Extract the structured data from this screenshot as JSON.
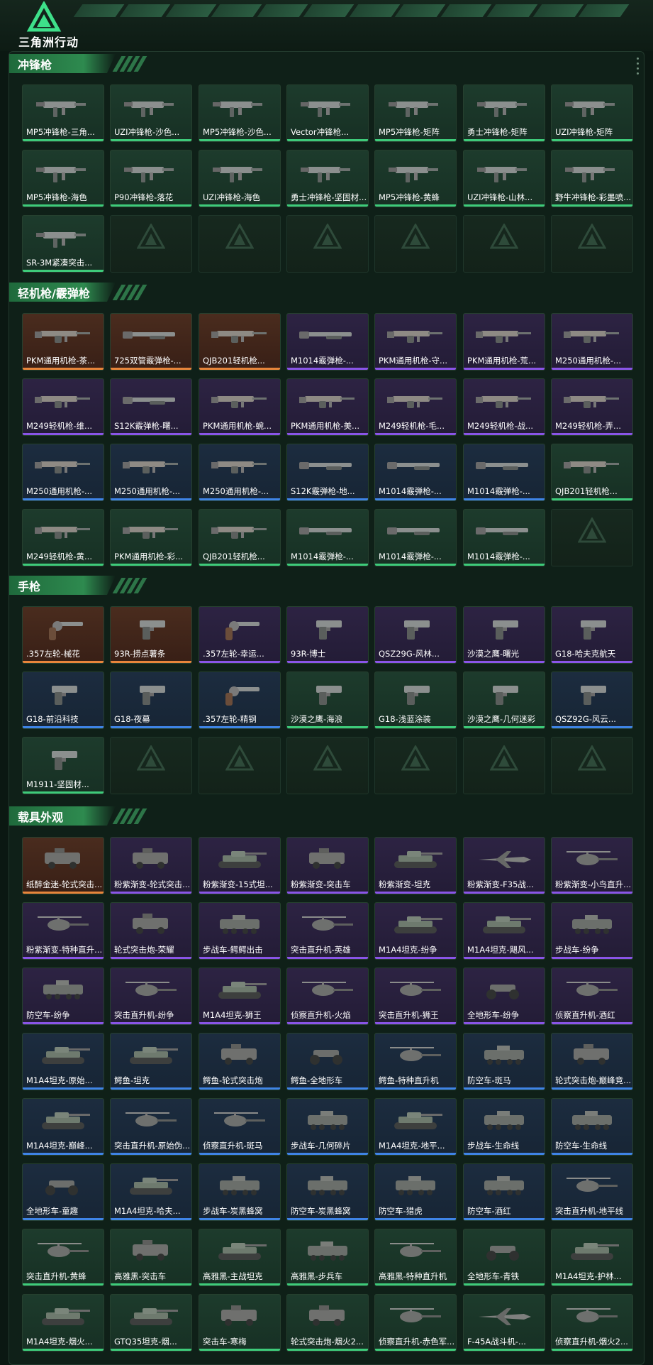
{
  "app": {
    "logo_text": "三角洲行动"
  },
  "colors": {
    "green": "#3ecb7a",
    "blue": "#3f84e6",
    "purple": "#8a55e8",
    "orange": "#e8853b"
  },
  "sections": [
    {
      "title": "冲锋枪",
      "items": [
        {
          "label": "MP5冲锋枪-三角...",
          "rarity": "green",
          "icon": "smg-icon"
        },
        {
          "label": "UZI冲锋枪-沙色...",
          "rarity": "green",
          "icon": "smg-icon"
        },
        {
          "label": "MP5冲锋枪-沙色...",
          "rarity": "green",
          "icon": "smg-icon"
        },
        {
          "label": "Vector冲锋枪...",
          "rarity": "green",
          "icon": "smg-icon"
        },
        {
          "label": "MP5冲锋枪-矩阵",
          "rarity": "green",
          "icon": "smg-icon"
        },
        {
          "label": "勇士冲锋枪-矩阵",
          "rarity": "green",
          "icon": "smg-icon"
        },
        {
          "label": "UZI冲锋枪-矩阵",
          "rarity": "green",
          "icon": "smg-icon"
        },
        {
          "label": "MP5冲锋枪-海色",
          "rarity": "green",
          "icon": "smg-icon"
        },
        {
          "label": "P90冲锋枪-落花",
          "rarity": "green",
          "icon": "smg-icon"
        },
        {
          "label": "UZI冲锋枪-海色",
          "rarity": "green",
          "icon": "smg-icon"
        },
        {
          "label": "勇士冲锋枪-坚固材...",
          "rarity": "green",
          "icon": "smg-icon"
        },
        {
          "label": "MP5冲锋枪-黄蜂",
          "rarity": "green",
          "icon": "smg-icon"
        },
        {
          "label": "UZI冲锋枪-山林...",
          "rarity": "green",
          "icon": "smg-icon"
        },
        {
          "label": "野牛冲锋枪-彩墨喷...",
          "rarity": "green",
          "icon": "smg-icon"
        },
        {
          "label": "SR-3M紧凑突击...",
          "rarity": "green",
          "icon": "smg-icon"
        },
        {
          "label": "",
          "rarity": "empty"
        },
        {
          "label": "",
          "rarity": "empty"
        },
        {
          "label": "",
          "rarity": "empty"
        },
        {
          "label": "",
          "rarity": "empty"
        },
        {
          "label": "",
          "rarity": "empty"
        },
        {
          "label": "",
          "rarity": "empty"
        }
      ]
    },
    {
      "title": "轻机枪/霰弹枪",
      "items": [
        {
          "label": "PKM通用机枪-茶...",
          "rarity": "orange",
          "icon": "lmg-icon"
        },
        {
          "label": "725双管霰弹枪-...",
          "rarity": "orange",
          "icon": "shotgun-icon"
        },
        {
          "label": "QJB201轻机枪...",
          "rarity": "orange",
          "icon": "lmg-icon"
        },
        {
          "label": "M1014霰弹枪-...",
          "rarity": "purple",
          "icon": "shotgun-icon"
        },
        {
          "label": "PKM通用机枪-守...",
          "rarity": "purple",
          "icon": "lmg-icon"
        },
        {
          "label": "PKM通用机枪-荒...",
          "rarity": "purple",
          "icon": "lmg-icon"
        },
        {
          "label": "M250通用机枪-...",
          "rarity": "purple",
          "icon": "lmg-icon"
        },
        {
          "label": "M249轻机枪-维...",
          "rarity": "purple",
          "icon": "lmg-icon"
        },
        {
          "label": "S12K霰弹枪-曙...",
          "rarity": "purple",
          "icon": "shotgun-icon"
        },
        {
          "label": "PKM通用机枪-蜿...",
          "rarity": "purple",
          "icon": "lmg-icon"
        },
        {
          "label": "PKM通用机枪-美...",
          "rarity": "purple",
          "icon": "lmg-icon"
        },
        {
          "label": "M249轻机枪-毛...",
          "rarity": "purple",
          "icon": "lmg-icon"
        },
        {
          "label": "M249轻机枪-战...",
          "rarity": "purple",
          "icon": "lmg-icon"
        },
        {
          "label": "M249轻机枪-弄...",
          "rarity": "purple",
          "icon": "lmg-icon"
        },
        {
          "label": "M250通用机枪-...",
          "rarity": "blue",
          "icon": "lmg-icon"
        },
        {
          "label": "M250通用机枪-...",
          "rarity": "blue",
          "icon": "lmg-icon"
        },
        {
          "label": "M250通用机枪-...",
          "rarity": "blue",
          "icon": "lmg-icon"
        },
        {
          "label": "S12K霰弹枪-地...",
          "rarity": "blue",
          "icon": "shotgun-icon"
        },
        {
          "label": "M1014霰弹枪-...",
          "rarity": "blue",
          "icon": "shotgun-icon"
        },
        {
          "label": "M1014霰弹枪-...",
          "rarity": "blue",
          "icon": "shotgun-icon"
        },
        {
          "label": "QJB201轻机枪...",
          "rarity": "green",
          "icon": "lmg-icon"
        },
        {
          "label": "M249轻机枪-黄...",
          "rarity": "green",
          "icon": "lmg-icon"
        },
        {
          "label": "PKM通用机枪-彩...",
          "rarity": "green",
          "icon": "lmg-icon"
        },
        {
          "label": "QJB201轻机枪...",
          "rarity": "green",
          "icon": "lmg-icon"
        },
        {
          "label": "M1014霰弹枪-...",
          "rarity": "green",
          "icon": "shotgun-icon"
        },
        {
          "label": "M1014霰弹枪-...",
          "rarity": "green",
          "icon": "shotgun-icon"
        },
        {
          "label": "M1014霰弹枪-...",
          "rarity": "green",
          "icon": "shotgun-icon"
        },
        {
          "label": "",
          "rarity": "empty"
        }
      ]
    },
    {
      "title": "手枪",
      "items": [
        {
          "label": ".357左轮-械花",
          "rarity": "orange",
          "icon": "revolver-icon"
        },
        {
          "label": "93R-捞点薯条",
          "rarity": "orange",
          "icon": "pistol-icon"
        },
        {
          "label": ".357左轮-幸运...",
          "rarity": "purple",
          "icon": "revolver-icon"
        },
        {
          "label": "93R-博士",
          "rarity": "purple",
          "icon": "pistol-icon"
        },
        {
          "label": "QSZ29G-风林...",
          "rarity": "purple",
          "icon": "pistol-icon"
        },
        {
          "label": "沙漠之鹰-曙光",
          "rarity": "purple",
          "icon": "pistol-icon"
        },
        {
          "label": "G18-哈夫克航天",
          "rarity": "purple",
          "icon": "pistol-icon"
        },
        {
          "label": "G18-前沿科技",
          "rarity": "blue",
          "icon": "pistol-icon"
        },
        {
          "label": "G18-夜幕",
          "rarity": "blue",
          "icon": "pistol-icon"
        },
        {
          "label": ".357左轮-精钢",
          "rarity": "blue",
          "icon": "revolver-icon"
        },
        {
          "label": "沙漠之鹰-海浪",
          "rarity": "green",
          "icon": "pistol-icon"
        },
        {
          "label": "G18-浅蓝涂装",
          "rarity": "green",
          "icon": "pistol-icon"
        },
        {
          "label": "沙漠之鹰-几何迷彩",
          "rarity": "green",
          "icon": "pistol-icon"
        },
        {
          "label": "QSZ92G-风云...",
          "rarity": "blue",
          "icon": "pistol-icon"
        },
        {
          "label": "M1911-坚固材...",
          "rarity": "green",
          "icon": "pistol-icon"
        },
        {
          "label": "",
          "rarity": "empty"
        },
        {
          "label": "",
          "rarity": "empty"
        },
        {
          "label": "",
          "rarity": "empty"
        },
        {
          "label": "",
          "rarity": "empty"
        },
        {
          "label": "",
          "rarity": "empty"
        },
        {
          "label": "",
          "rarity": "empty"
        }
      ]
    },
    {
      "title": "载具外观",
      "items": [
        {
          "label": "纸醉金迷-轮式突击...",
          "rarity": "orange",
          "icon": "armored-car-icon"
        },
        {
          "label": "粉紫渐变-轮式突击...",
          "rarity": "purple",
          "icon": "armored-car-icon"
        },
        {
          "label": "粉紫渐变-15式坦...",
          "rarity": "purple",
          "icon": "tank-icon"
        },
        {
          "label": "粉紫渐变-突击车",
          "rarity": "purple",
          "icon": "armored-car-icon"
        },
        {
          "label": "粉紫渐变-坦克",
          "rarity": "purple",
          "icon": "tank-icon"
        },
        {
          "label": "粉紫渐变-F35战...",
          "rarity": "purple",
          "icon": "jet-icon"
        },
        {
          "label": "粉紫渐变-小鸟直升...",
          "rarity": "purple",
          "icon": "helicopter-icon"
        },
        {
          "label": "粉紫渐变-特种直升...",
          "rarity": "purple",
          "icon": "helicopter-icon"
        },
        {
          "label": "轮式突击炮-荣耀",
          "rarity": "purple",
          "icon": "armored-car-icon"
        },
        {
          "label": "步战车-鳄鳄出击",
          "rarity": "purple",
          "icon": "ifv-icon"
        },
        {
          "label": "突击直升机-英雄",
          "rarity": "purple",
          "icon": "helicopter-icon"
        },
        {
          "label": "M1A4坦克-纷争",
          "rarity": "purple",
          "icon": "tank-icon"
        },
        {
          "label": "M1A4坦克-飓风...",
          "rarity": "purple",
          "icon": "tank-icon"
        },
        {
          "label": "步战车-纷争",
          "rarity": "purple",
          "icon": "ifv-icon"
        },
        {
          "label": "防空车-纷争",
          "rarity": "purple",
          "icon": "ifv-icon"
        },
        {
          "label": "突击直升机-纷争",
          "rarity": "purple",
          "icon": "helicopter-icon"
        },
        {
          "label": "M1A4坦克-狮王",
          "rarity": "purple",
          "icon": "tank-icon"
        },
        {
          "label": "侦察直升机-火焰",
          "rarity": "purple",
          "icon": "helicopter-icon"
        },
        {
          "label": "突击直升机-狮王",
          "rarity": "purple",
          "icon": "helicopter-icon"
        },
        {
          "label": "全地形车-纷争",
          "rarity": "purple",
          "icon": "atv-icon"
        },
        {
          "label": "侦察直升机-酒红",
          "rarity": "purple",
          "icon": "helicopter-icon"
        },
        {
          "label": "M1A4坦克-原始...",
          "rarity": "blue",
          "icon": "tank-icon"
        },
        {
          "label": "鳄鱼-坦克",
          "rarity": "blue",
          "icon": "tank-icon"
        },
        {
          "label": "鳄鱼-轮式突击炮",
          "rarity": "blue",
          "icon": "armored-car-icon"
        },
        {
          "label": "鳄鱼-全地形车",
          "rarity": "blue",
          "icon": "atv-icon"
        },
        {
          "label": "鳄鱼-特种直升机",
          "rarity": "blue",
          "icon": "helicopter-icon"
        },
        {
          "label": "防空车-斑马",
          "rarity": "blue",
          "icon": "ifv-icon"
        },
        {
          "label": "轮式突击炮-巅峰竞...",
          "rarity": "blue",
          "icon": "armored-car-icon"
        },
        {
          "label": "M1A4坦克-巅峰...",
          "rarity": "blue",
          "icon": "tank-icon"
        },
        {
          "label": "突击直升机-原始伪...",
          "rarity": "blue",
          "icon": "helicopter-icon"
        },
        {
          "label": "侦察直升机-斑马",
          "rarity": "blue",
          "icon": "helicopter-icon"
        },
        {
          "label": "步战车-几何碎片",
          "rarity": "blue",
          "icon": "ifv-icon"
        },
        {
          "label": "M1A4坦克-地平...",
          "rarity": "blue",
          "icon": "tank-icon"
        },
        {
          "label": "步战车-生命线",
          "rarity": "blue",
          "icon": "ifv-icon"
        },
        {
          "label": "防空车-生命线",
          "rarity": "blue",
          "icon": "ifv-icon"
        },
        {
          "label": "全地形车-童趣",
          "rarity": "blue",
          "icon": "atv-icon"
        },
        {
          "label": "M1A4坦克-哈夫...",
          "rarity": "blue",
          "icon": "tank-icon"
        },
        {
          "label": "步战车-炭黑蜂窝",
          "rarity": "blue",
          "icon": "ifv-icon"
        },
        {
          "label": "防空车-炭黑蜂窝",
          "rarity": "blue",
          "icon": "ifv-icon"
        },
        {
          "label": "防空车-猎虎",
          "rarity": "blue",
          "icon": "ifv-icon"
        },
        {
          "label": "防空车-酒红",
          "rarity": "blue",
          "icon": "ifv-icon"
        },
        {
          "label": "突击直升机-地平线",
          "rarity": "blue",
          "icon": "helicopter-icon"
        },
        {
          "label": "突击直升机-黄蜂",
          "rarity": "green",
          "icon": "helicopter-icon"
        },
        {
          "label": "高雅黑-突击车",
          "rarity": "green",
          "icon": "armored-car-icon"
        },
        {
          "label": "高雅黑-主战坦克",
          "rarity": "green",
          "icon": "tank-icon"
        },
        {
          "label": "高雅黑-步兵车",
          "rarity": "green",
          "icon": "ifv-icon"
        },
        {
          "label": "高雅黑-特种直升机",
          "rarity": "green",
          "icon": "helicopter-icon"
        },
        {
          "label": "全地形车-青铁",
          "rarity": "green",
          "icon": "atv-icon"
        },
        {
          "label": "M1A4坦克-护林...",
          "rarity": "green",
          "icon": "tank-icon"
        },
        {
          "label": "M1A4坦克-烟火...",
          "rarity": "green",
          "icon": "tank-icon"
        },
        {
          "label": "GTQ35坦克-烟...",
          "rarity": "green",
          "icon": "tank-icon"
        },
        {
          "label": "突击车-寒梅",
          "rarity": "green",
          "icon": "armored-car-icon"
        },
        {
          "label": "轮式突击炮-烟火2...",
          "rarity": "green",
          "icon": "armored-car-icon"
        },
        {
          "label": "侦察直升机-赤色军...",
          "rarity": "green",
          "icon": "helicopter-icon"
        },
        {
          "label": "F-45A战斗机-...",
          "rarity": "green",
          "icon": "jet-icon"
        },
        {
          "label": "侦察直升机-烟火2...",
          "rarity": "green",
          "icon": "helicopter-icon"
        }
      ]
    }
  ]
}
